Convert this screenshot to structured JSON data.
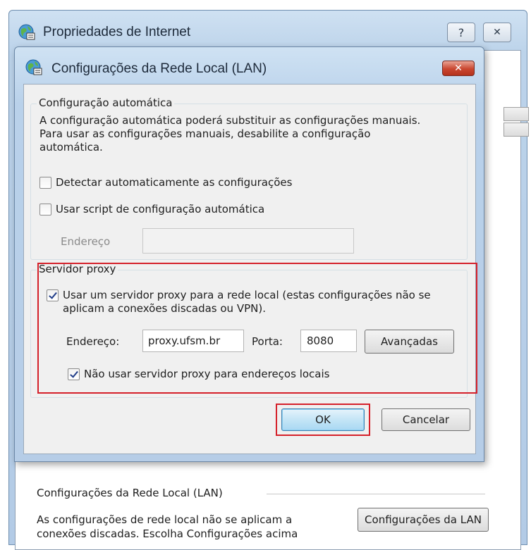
{
  "outer_window": {
    "title": "Propriedades de Internet",
    "help_label": "?",
    "close_label": "✕",
    "lan_section": {
      "label": "Configurações da Rede Local (LAN)",
      "description": "As configurações de rede local não se aplicam a conexões discadas. Escolha Configurações acima",
      "button_label": "Configurações da LAN"
    }
  },
  "lan_dialog": {
    "title": "Configurações da Rede Local (LAN)",
    "close_label": "✕",
    "auto_config": {
      "legend": "Configuração automática",
      "description": "A configuração automática poderá substituir as configurações manuais. Para usar as configurações manuais, desabilite a configuração automática.",
      "detect_label": "Detectar automaticamente as configurações",
      "detect_checked": false,
      "script_label": "Usar script de configuração automática",
      "script_checked": false,
      "address_label": "Endereço",
      "address_value": ""
    },
    "proxy": {
      "legend": "Servidor proxy",
      "use_proxy_label": "Usar um servidor proxy para a rede local (estas configurações não se aplicam a conexões discadas ou VPN).",
      "use_proxy_checked": true,
      "address_label": "Endereço:",
      "address_value": "proxy.ufsm.br",
      "port_label": "Porta:",
      "port_value": "8080",
      "advanced_label": "Avançadas",
      "bypass_label": "Não usar servidor proxy para endereços locais",
      "bypass_checked": true
    },
    "ok_label": "OK",
    "cancel_label": "Cancelar"
  },
  "colors": {
    "highlight": "#d5202a",
    "title_bar": "#b9d1ea",
    "dialog_body": "#f0f0f0"
  },
  "icons": {
    "window_icon": "globe-network-icon"
  }
}
